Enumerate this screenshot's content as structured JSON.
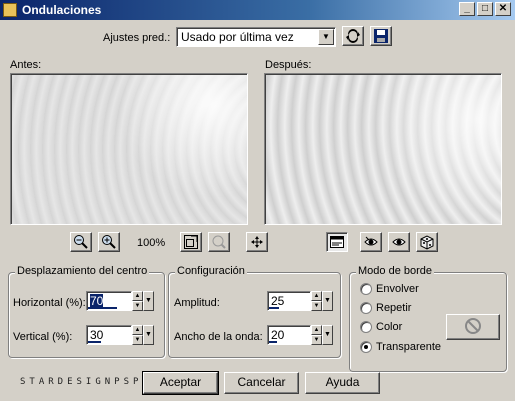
{
  "window": {
    "title": "Ondulaciones",
    "minimize_glyph": "_",
    "maximize_glyph": "□",
    "close_glyph": "✕"
  },
  "presets": {
    "label": "Ajustes pred.:",
    "selected": "Usado por última vez"
  },
  "previews": {
    "before_label": "Antes:",
    "after_label": "Después:"
  },
  "toolbar": {
    "zoom_level": "100%"
  },
  "center_offset": {
    "title": "Desplazamiento del centro",
    "horizontal_label": "Horizontal (%):",
    "horizontal_value": "70",
    "horizontal_fraction": 0.7,
    "vertical_label": "Vertical (%):",
    "vertical_value": "30",
    "vertical_fraction": 0.3
  },
  "configuration": {
    "title": "Configuración",
    "amplitude_label": "Amplitud:",
    "amplitude_value": "25",
    "amplitude_fraction": 0.25,
    "wavelength_label": "Ancho de la onda:",
    "wavelength_value": "20",
    "wavelength_fraction": 0.2
  },
  "edge_mode": {
    "title": "Modo de borde",
    "options": [
      "Envolver",
      "Repetir",
      "Color",
      "Transparente"
    ],
    "selected": "Transparente"
  },
  "buttons": {
    "ok": "Aceptar",
    "cancel": "Cancelar",
    "help": "Ayuda"
  },
  "watermark": "STARDESIGNPSP",
  "colors": {
    "title_bar_start": "#0a246a",
    "title_bar_end": "#a6caf0",
    "dialog_bg": "#d4d0c8",
    "selection": "#0a246a"
  },
  "icons": {
    "zoom_out": "zoom-out-icon",
    "zoom_in": "zoom-in-icon",
    "zoom_fit": "zoom-fit-icon",
    "zoom_actual": "zoom-actual-icon",
    "pan": "pan-icon",
    "toggle_preview": "toggle-preview-icon",
    "proof": "proof-icon",
    "auto_proof": "auto-proof-icon",
    "randomize": "randomize-icon",
    "reset": "reset-icon",
    "save_preset": "save-icon"
  }
}
